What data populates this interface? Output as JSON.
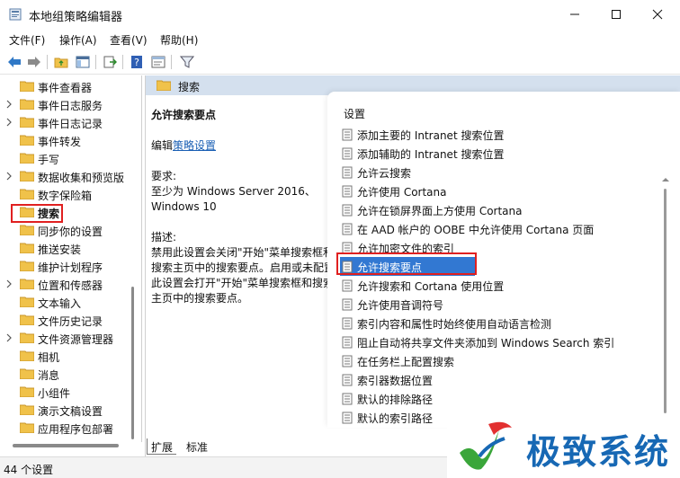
{
  "window": {
    "title": "本地组策略编辑器"
  },
  "menu": [
    "文件(F)",
    "操作(A)",
    "查看(V)",
    "帮助(H)"
  ],
  "tree": {
    "items": [
      {
        "label": "事件查看器",
        "expand": false
      },
      {
        "label": "事件日志服务",
        "expand": true
      },
      {
        "label": "事件日志记录",
        "expand": true
      },
      {
        "label": "事件转发",
        "expand": false
      },
      {
        "label": "手写",
        "expand": false
      },
      {
        "label": "数据收集和预览版",
        "expand": true
      },
      {
        "label": "数字保险箱",
        "expand": false
      },
      {
        "label": "搜索",
        "expand": false,
        "selected": true
      },
      {
        "label": "同步你的设置",
        "expand": false
      },
      {
        "label": "推送安装",
        "expand": false
      },
      {
        "label": "维护计划程序",
        "expand": false
      },
      {
        "label": "位置和传感器",
        "expand": true
      },
      {
        "label": "文本输入",
        "expand": false
      },
      {
        "label": "文件历史记录",
        "expand": false
      },
      {
        "label": "文件资源管理器",
        "expand": true
      },
      {
        "label": "相机",
        "expand": false
      },
      {
        "label": "消息",
        "expand": false
      },
      {
        "label": "小组件",
        "expand": false
      },
      {
        "label": "演示文稿设置",
        "expand": false
      },
      {
        "label": "应用程序包部署",
        "expand": false
      }
    ]
  },
  "right": {
    "header": "搜索",
    "desc": {
      "title": "允许搜索要点",
      "edit_prefix": "编辑",
      "edit_link": "策略设置",
      "req_label": "要求:",
      "req_line1": "至少为 Windows Server 2016、",
      "req_line2": "Windows 10",
      "desc_label": "描述:",
      "desc_text": "禁用此设置会关闭\"开始\"菜单搜索框和搜索主页中的搜索要点。启用或未配置此设置会打开\"开始\"菜单搜索框和搜索主页中的搜索要点。"
    },
    "list": {
      "header": "设置",
      "rows": [
        "添加主要的 Intranet 搜索位置",
        "添加辅助的 Intranet 搜索位置",
        "允许云搜索",
        "允许使用 Cortana",
        "允许在锁屏界面上方使用 Cortana",
        "在 AAD 帐户的 OOBE 中允许使用 Cortana 页面",
        "允许加密文件的索引",
        "允许搜索要点",
        "允许搜索和 Cortana 使用位置",
        "允许使用音调符号",
        "索引内容和属性时始终使用自动语言检测",
        "阻止自动将共享文件夹添加到 Windows Search 索引",
        "在任务栏上配置搜索",
        "索引器数据位置",
        "默认的排除路径",
        "默认的索引路径"
      ],
      "selected_index": 7
    }
  },
  "tabs": [
    "扩展",
    "标准"
  ],
  "status": {
    "text": "44 个设置"
  },
  "watermark": {
    "text": "极致系统"
  },
  "colors": {
    "accent": "#3278d2",
    "highlight": "#e02020",
    "header_bg": "#d4e0ee",
    "folder": "#f0c24a"
  }
}
